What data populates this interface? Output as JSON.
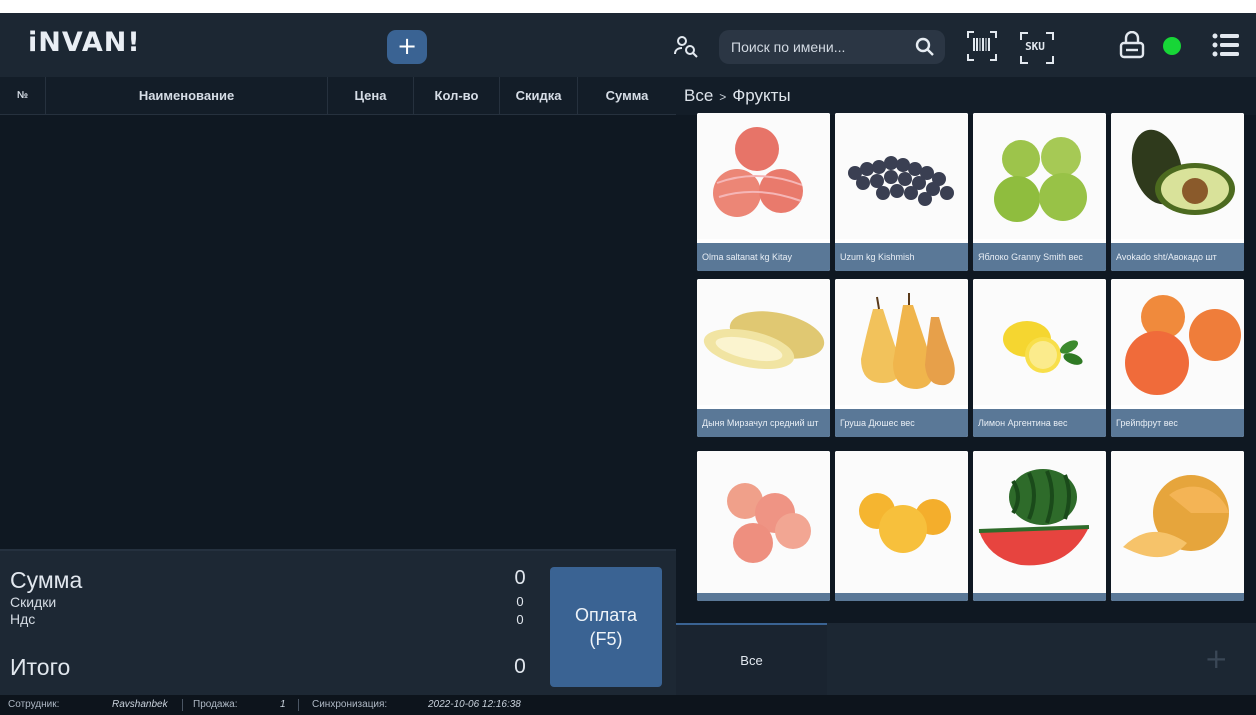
{
  "app": {
    "logo": "iNVAN!",
    "add_label": "+",
    "search_placeholder": "Поиск по имени...",
    "barcode_icon": "barcode-icon",
    "sku_label": "SKU",
    "status_color": "#17d637"
  },
  "table": {
    "headers": [
      "№",
      "Наименование",
      "Цена",
      "Кол-во",
      "Скидка",
      "Сумма"
    ]
  },
  "breadcrumb": {
    "root": "Все",
    "separator": ">",
    "current": "Фрукты"
  },
  "totals": {
    "sum_label": "Сумма",
    "sum_value": "0",
    "discount_label": "Скидки",
    "discount_value": "0",
    "vat_label": "Ндс",
    "vat_value": "0",
    "total_label": "Итого",
    "total_value": "0",
    "pay_label_1": "Оплата",
    "pay_label_2": "(F5)"
  },
  "status": {
    "employee_label": "Сотрудник:",
    "employee_value": "Ravshanbek",
    "sale_label": "Продажа:",
    "sale_value": "1",
    "sync_label": "Синхронизация:",
    "sync_value": "2022-10-06 12:16:38"
  },
  "products": [
    {
      "name": "Olma saltanat kg Kitay",
      "image": "red-apples"
    },
    {
      "name": "Uzum kg Kishmish",
      "image": "dark-grapes"
    },
    {
      "name": "Яблоко Granny Smith вес",
      "image": "green-apples"
    },
    {
      "name": "Avokado sht/Авокадо шт",
      "image": "avocado"
    },
    {
      "name": "Дыня Мирзачул средний шт",
      "image": "melon-long"
    },
    {
      "name": "Груша Дюшес вес",
      "image": "pears"
    },
    {
      "name": "Лимон Аргентина вес",
      "image": "lemon"
    },
    {
      "name": "Грейпфрут вес",
      "image": "grapefruit"
    },
    {
      "name": "",
      "image": "pink-apples"
    },
    {
      "name": "",
      "image": "oranges"
    },
    {
      "name": "",
      "image": "watermelon"
    },
    {
      "name": "",
      "image": "cantaloupe"
    }
  ],
  "categories": {
    "tabs": [
      {
        "label": "Все"
      }
    ],
    "add_label": "+"
  }
}
